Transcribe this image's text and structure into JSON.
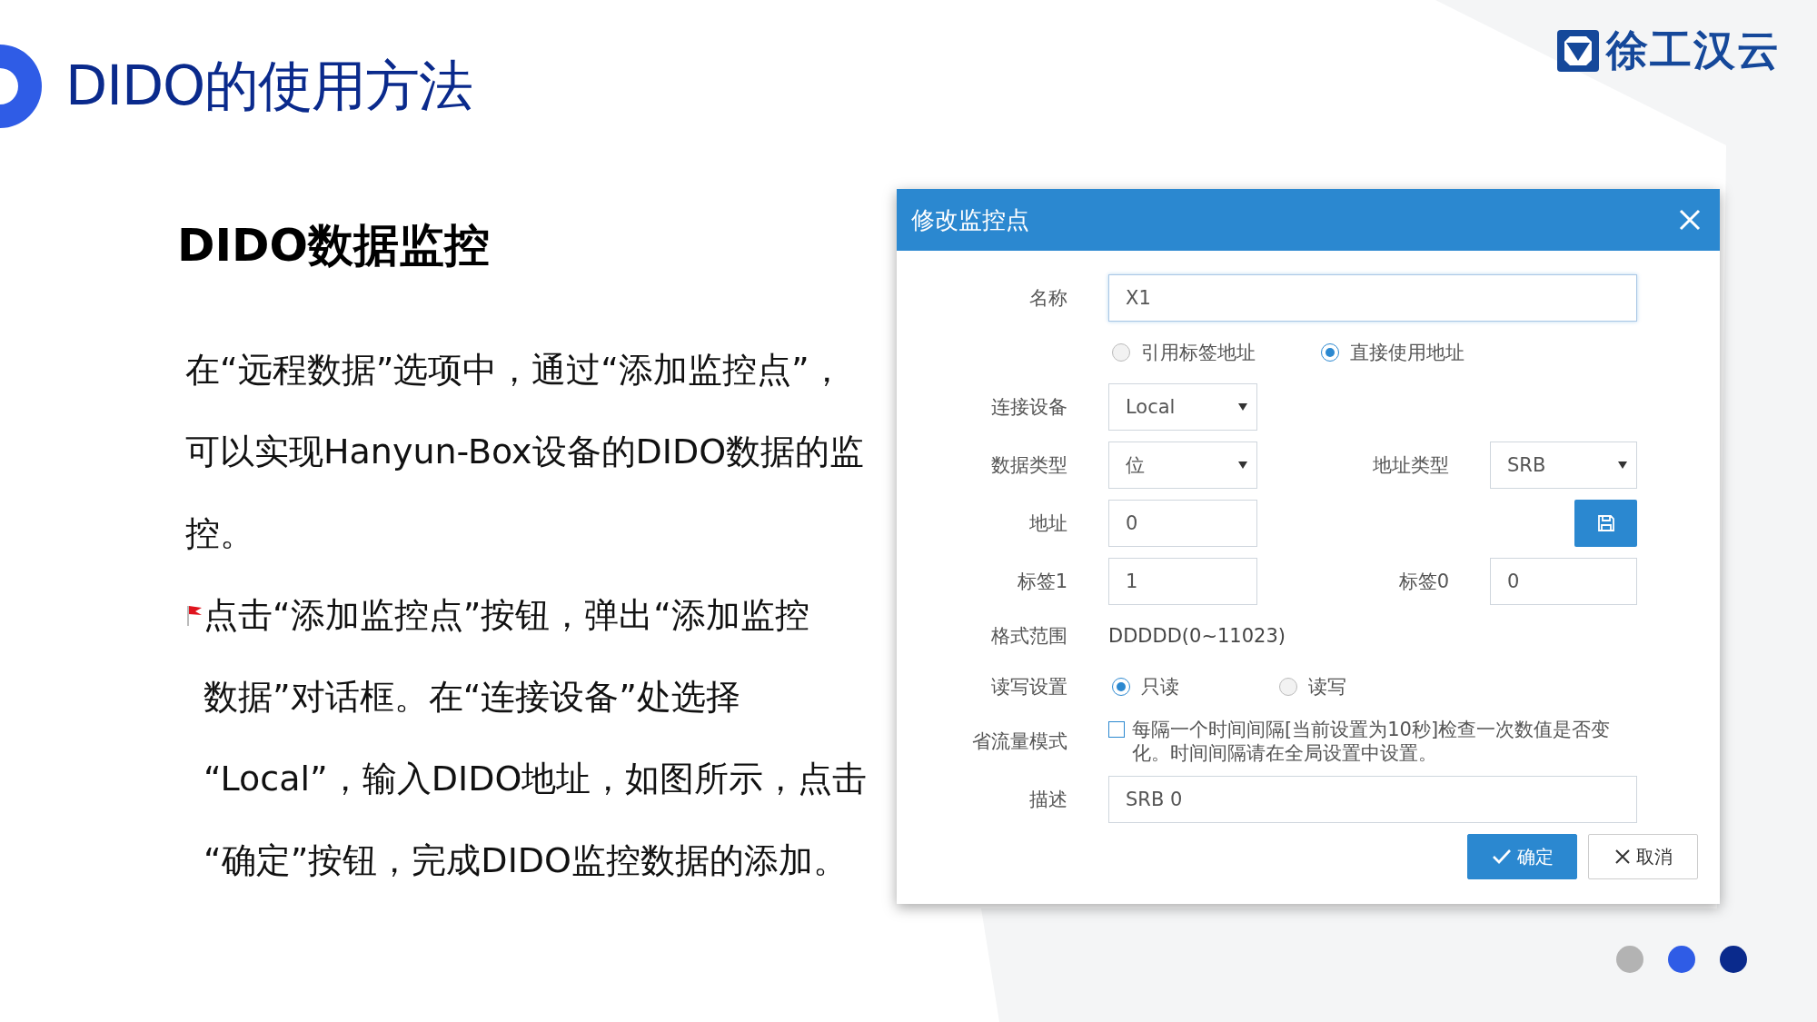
{
  "slide": {
    "title": "DIDO的使用方法",
    "logo_text": "徐工汉云",
    "subtitle": "DIDO数据监控",
    "paragraphs": [
      {
        "flag": false,
        "lines": [
          "在“远程数据”选项中，通过“添加监控点”，",
          "可以实现Hanyun-Box设备的DIDO数据的监",
          "控。"
        ]
      },
      {
        "flag": true,
        "lines": [
          "点击“添加监控点”按钮，弹出“添加监控",
          "数据”对话框。在“连接设备”处选择",
          "“Local”，输入DIDO地址，如图所示，点击",
          "“确定”按钮，完成DIDO监控数据的添加。"
        ]
      }
    ],
    "page_dots": [
      {
        "color": "#b3b3b3"
      },
      {
        "color": "#2f5ce6"
      },
      {
        "color": "#0a2a8c"
      }
    ]
  },
  "dialog": {
    "title": "修改监控点",
    "name": {
      "label": "名称",
      "value": "X1"
    },
    "address_mode": [
      {
        "label": "引用标签地址",
        "selected": false
      },
      {
        "label": "直接使用地址",
        "selected": true
      }
    ],
    "device": {
      "label": "连接设备",
      "value": "Local"
    },
    "data_type": {
      "label": "数据类型",
      "value": "位"
    },
    "address_type": {
      "label": "地址类型",
      "value": "SRB"
    },
    "address": {
      "label": "地址",
      "value": "0"
    },
    "tag1": {
      "label": "标签1",
      "value": "1"
    },
    "tag0": {
      "label": "标签0",
      "value": "0"
    },
    "format_range": {
      "label": "格式范围",
      "value": "DDDDD(0~11023)"
    },
    "read_write": {
      "label": "读写设置",
      "options": [
        {
          "label": "只读",
          "selected": true
        },
        {
          "label": "读写",
          "selected": false
        }
      ]
    },
    "traffic_saving": {
      "label": "省流量模式",
      "checked": false,
      "text": "每隔一个时间间隔[当前设置为10秒]检查一次数值是否变化。时间间隔请在全局设置中设置。"
    },
    "description": {
      "label": "描述",
      "value": "SRB 0"
    },
    "buttons": [
      {
        "kind": "confirm",
        "label": "确定"
      },
      {
        "kind": "cancel",
        "label": "取消"
      }
    ]
  }
}
